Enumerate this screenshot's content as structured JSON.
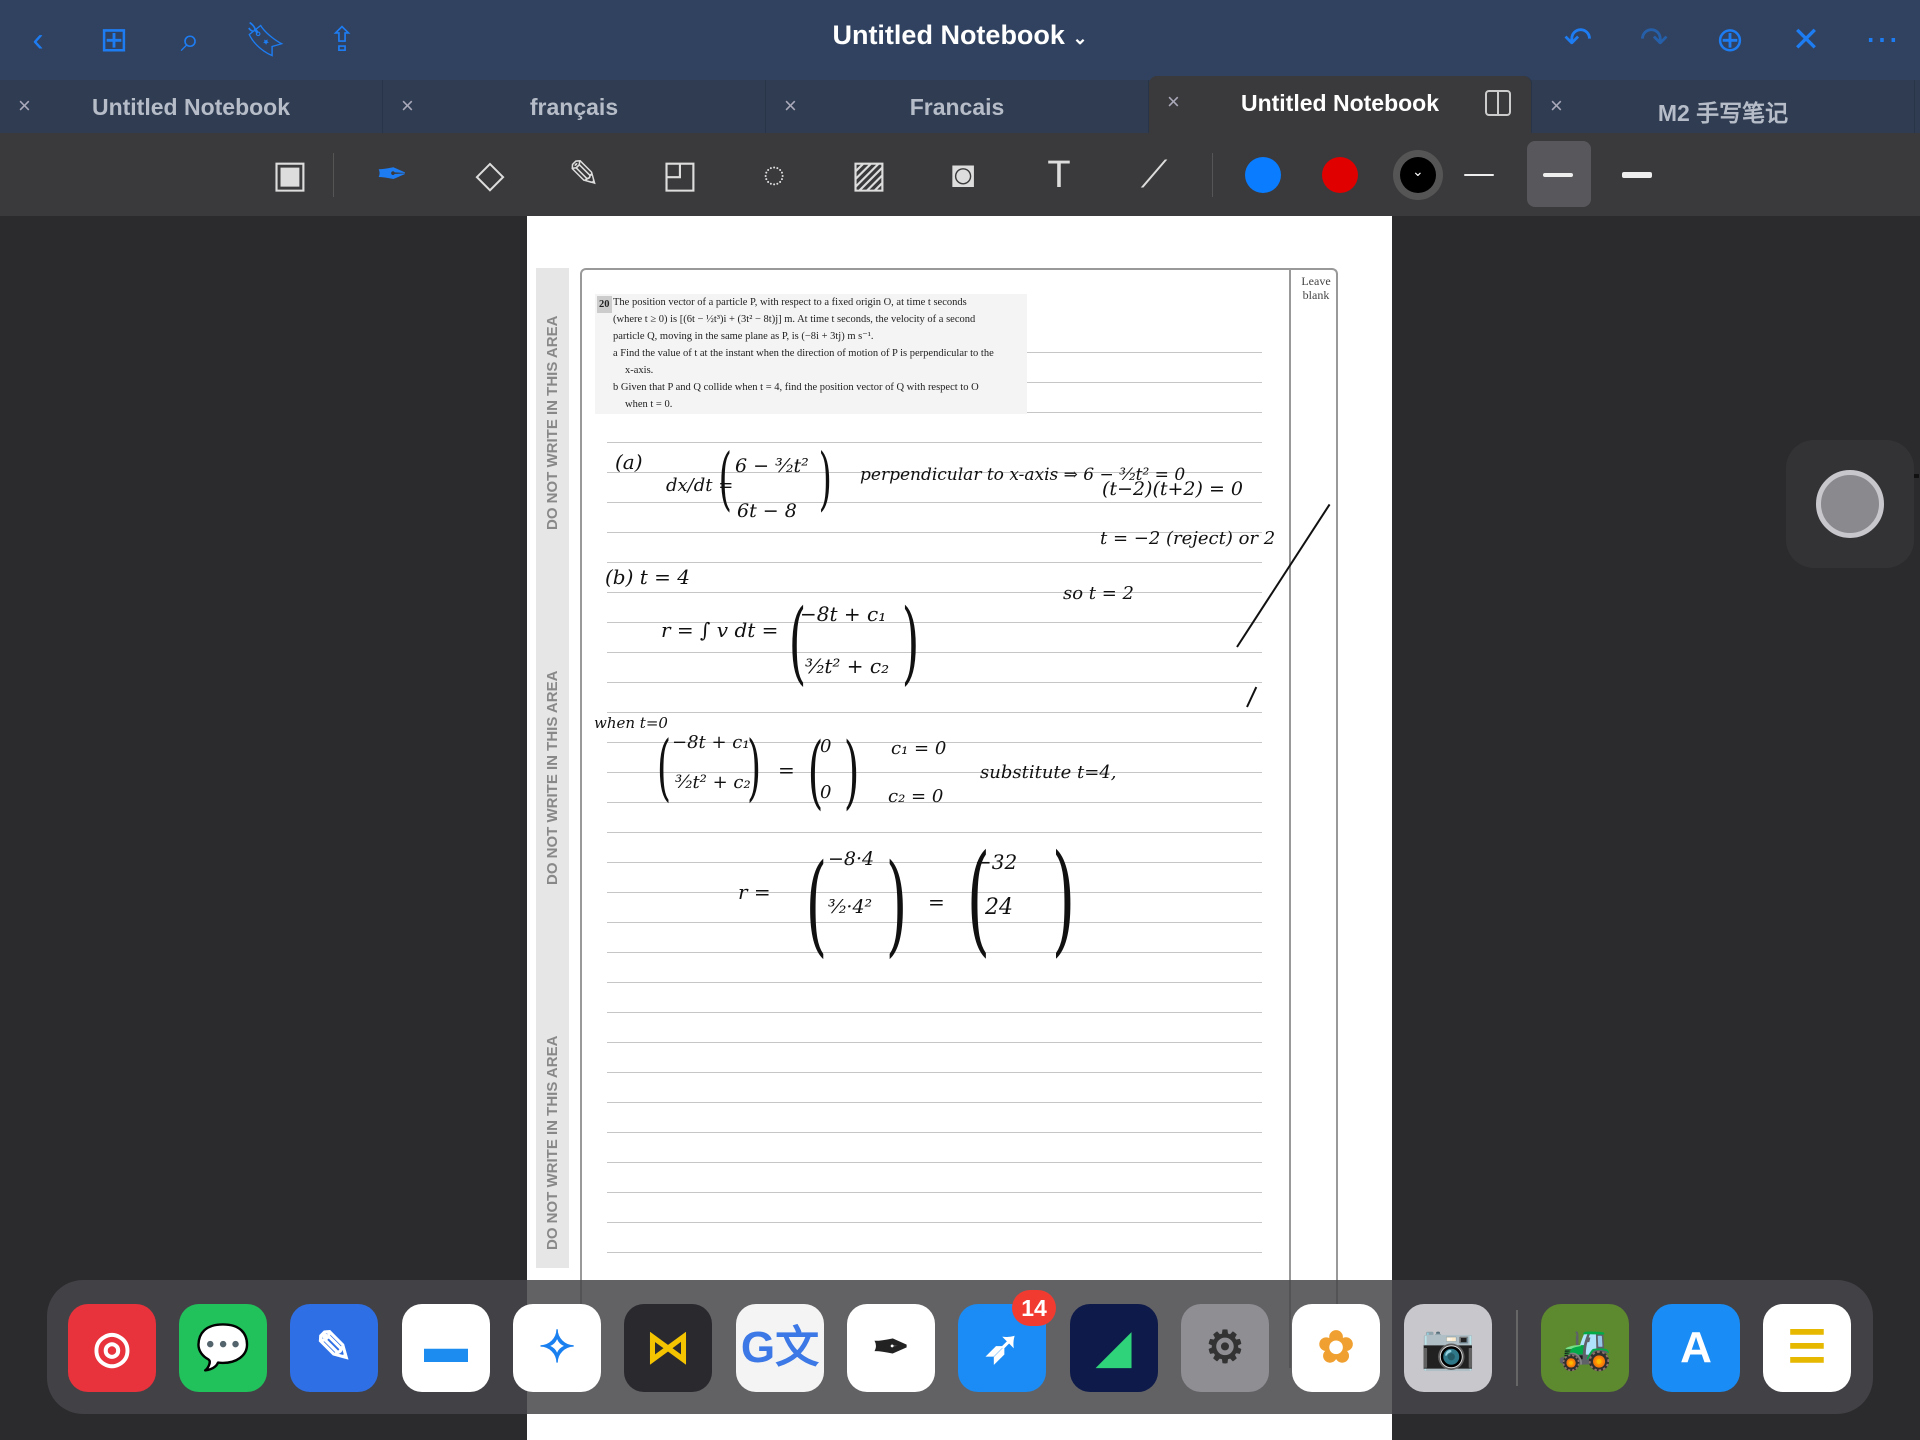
{
  "header": {
    "title": "Untitled Notebook",
    "title_chevron": "⌄",
    "left_icons": [
      "back-icon",
      "grid-icon",
      "search-icon",
      "bookmark-icon",
      "share-icon"
    ],
    "right_icons": [
      "undo-icon",
      "redo-icon",
      "add-page-icon",
      "close-icon",
      "more-icon"
    ]
  },
  "tabs": [
    {
      "label": "Untitled Notebook",
      "active": false
    },
    {
      "label": "français",
      "active": false
    },
    {
      "label": "Francais",
      "active": false
    },
    {
      "label": "Untitled Notebook",
      "active": true
    },
    {
      "label": "M2 手写笔记",
      "active": false
    }
  ],
  "tab_close": "×",
  "toolbar": {
    "tools": [
      "read-only-mode-icon",
      "pen-icon",
      "eraser-icon",
      "highlighter-icon",
      "shapes-icon",
      "lasso-icon",
      "image-icon",
      "camera-icon",
      "text-box-icon",
      "laser-pointer-icon"
    ],
    "colors": [
      "#0a7cff",
      "#e00000",
      "#000000"
    ],
    "selected_stroke": 2
  },
  "page": {
    "strip_text": "DO NOT WRITE IN THIS AREA",
    "leave_blank": "Leave blank",
    "question": {
      "number": "20",
      "lines": [
        "The position vector of a particle P, with respect to a fixed origin O, at time t seconds",
        "(where t ≥ 0) is [(6t − ½t³)i + (3t² − 8t)j] m. At time t seconds, the velocity of a second",
        "particle Q, moving in the same plane as P, is (−8i + 3tj) m s⁻¹."
      ],
      "part_a": "a  Find the value of t at the instant when the direction of motion of P is perpendicular to the",
      "part_a2": "x-axis.",
      "part_b": "b  Given that P and Q collide when t = 4, find the position vector of Q with respect to O",
      "part_b2": "when t = 0."
    },
    "handwriting": {
      "a_label": "(a)",
      "dxdt": "dx/dt =",
      "vec_a_top": "6 − ³⁄₂t²",
      "vec_a_bot": "6t − 8",
      "perp": "perpendicular to x-axis ⇒ 6 − ³⁄₂t² = 0",
      "factor": "(t−2)(t+2) = 0",
      "roots": "t = −2 (reject) or 2",
      "so": "so t = 2",
      "b_label": "(b)  t = 4",
      "r_int": "r = ∫ v dt =",
      "vec_b_top": "−8t + c₁",
      "vec_b_bot": "³⁄₂t² + c₂",
      "when": "when t=0",
      "vec_c_top": "−8t + c₁",
      "vec_c_bot": "³⁄₂t² + c₂",
      "eq": "=",
      "zero_top": "0",
      "zero_bot": "0",
      "c1": "c₁ = 0",
      "c2": "c₂ = 0",
      "subst": "substitute t=4,",
      "r": "r =",
      "vec_d_top": "−8·4",
      "vec_d_bot": "³⁄₂·4²",
      "eq2": "=",
      "vec_e_top": "−32",
      "vec_e_bot": "24"
    }
  },
  "dock": {
    "apps": [
      {
        "name": "netease-music",
        "bg": "#e8323c",
        "glyph": "◎"
      },
      {
        "name": "wechat",
        "bg": "#21c25c",
        "glyph": "💬"
      },
      {
        "name": "notability",
        "bg": "#2f6fe6",
        "glyph": "✎"
      },
      {
        "name": "files",
        "bg": "#ffffff",
        "glyph": "▬",
        "fg": "#1d8cf0"
      },
      {
        "name": "safari",
        "bg": "#ffffff",
        "glyph": "✧",
        "fg": "#1a80f0"
      },
      {
        "name": "infuse",
        "bg": "#2a2a2e",
        "glyph": "⋈",
        "fg": "#f5c400"
      },
      {
        "name": "google-translate",
        "bg": "#f4f4f4",
        "glyph": "G文",
        "fg": "#3c78e6"
      },
      {
        "name": "goodnotes",
        "bg": "#ffffff",
        "glyph": "✒",
        "fg": "#222"
      },
      {
        "name": "dingtalk",
        "bg": "#1b8cf5",
        "glyph": "➶",
        "badge": "14"
      },
      {
        "name": "lumafusion",
        "bg": "#0e1a4a",
        "glyph": "◢",
        "fg": "#2ed37a"
      },
      {
        "name": "settings",
        "bg": "#8e8e93",
        "glyph": "⚙",
        "fg": "#333"
      },
      {
        "name": "photos",
        "bg": "#ffffff",
        "glyph": "✿",
        "fg": "#f0a030"
      },
      {
        "name": "camera",
        "bg": "#c8c8cc",
        "glyph": "📷",
        "fg": "#333"
      },
      {
        "name": "farming-simulator",
        "bg": "#5d8a2e",
        "glyph": "🚜"
      },
      {
        "name": "app-store",
        "bg": "#1a8cf5",
        "glyph": "A"
      },
      {
        "name": "notes",
        "bg": "#ffffff",
        "glyph": "☰",
        "fg": "#e6b800"
      }
    ]
  }
}
